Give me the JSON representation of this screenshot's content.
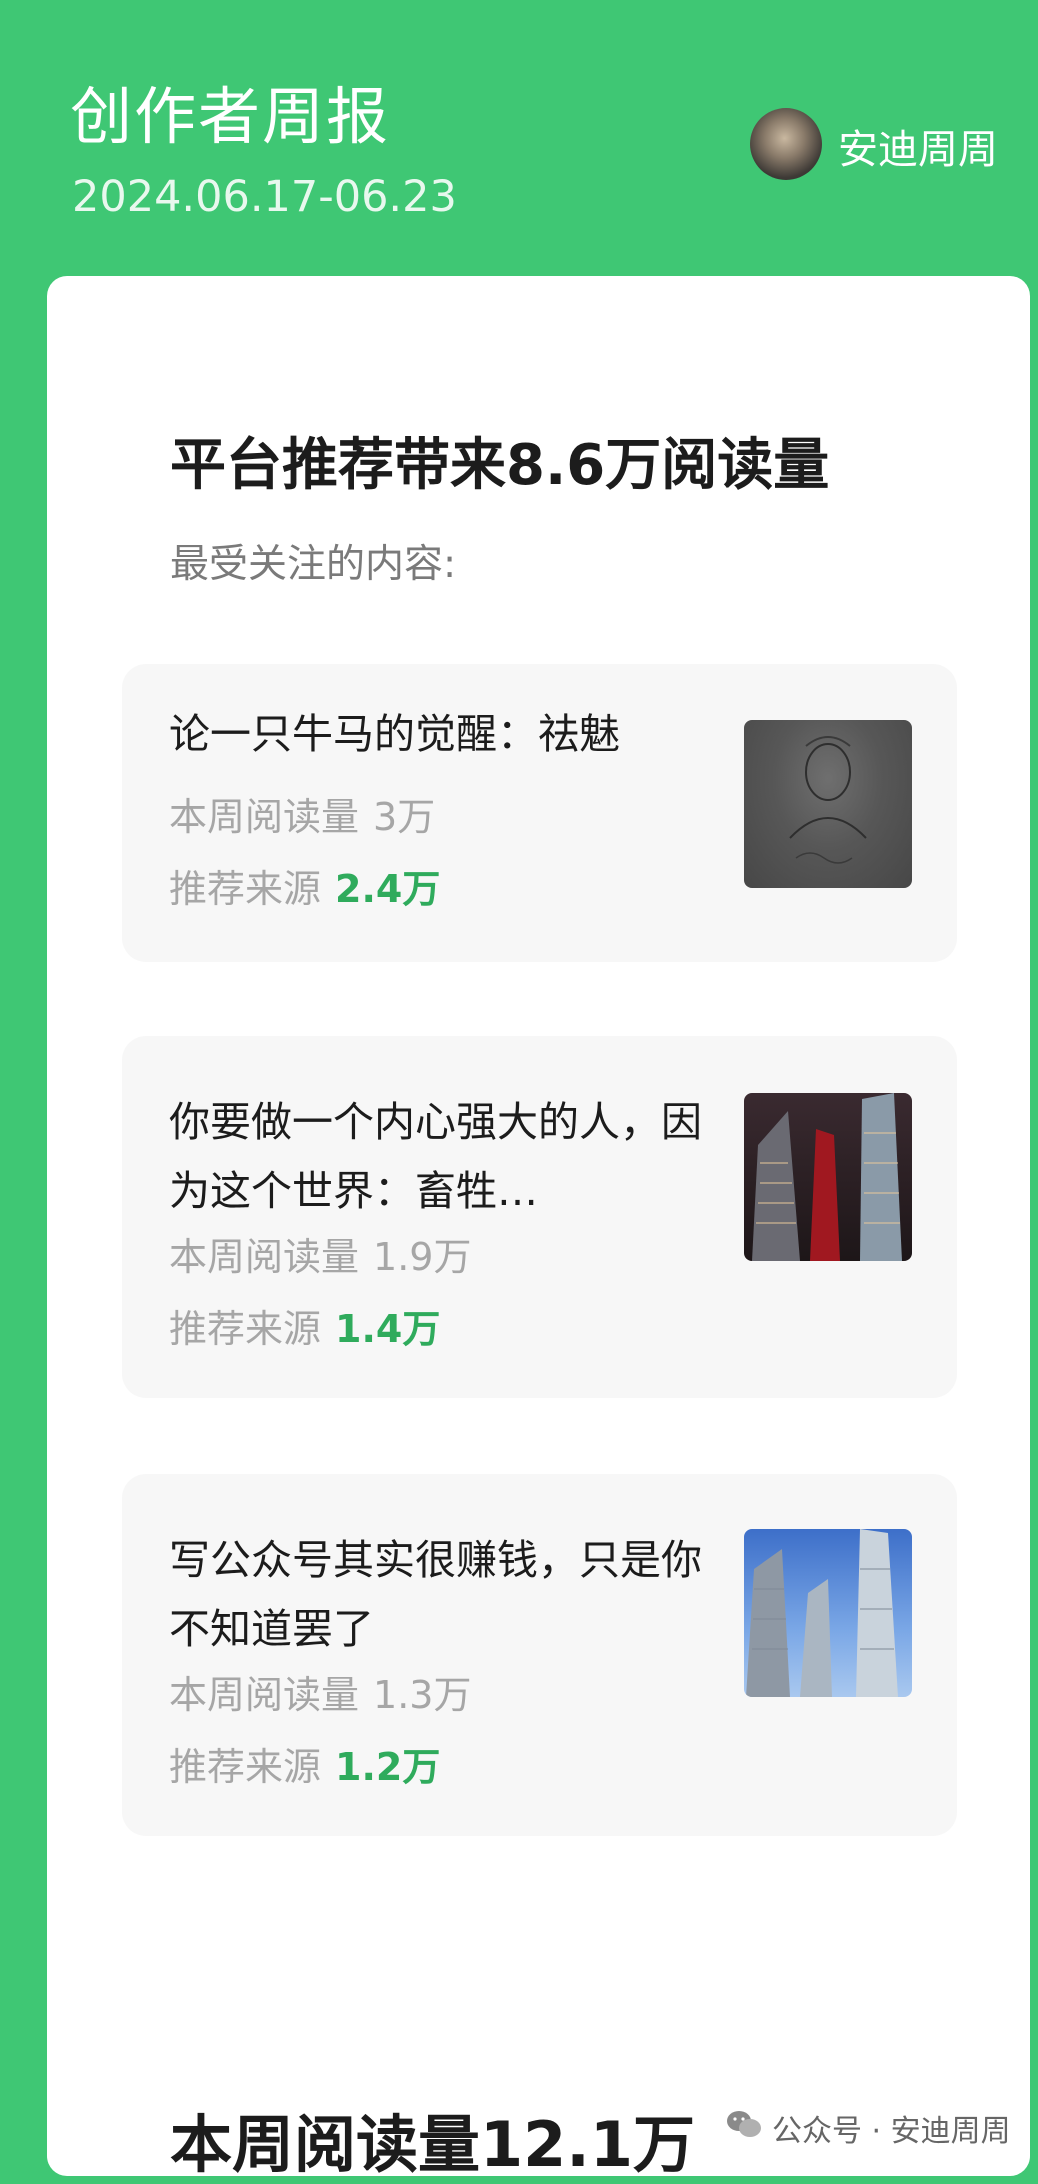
{
  "header": {
    "title": "创作者周报",
    "date_range": "2024.06.17-06.23",
    "user_name": "安迪周周"
  },
  "section": {
    "title": "平台推荐带来8.6万阅读量",
    "subtitle": "最受关注的内容:"
  },
  "labels": {
    "weekly_reads": "本周阅读量",
    "recommend_source": "推荐来源"
  },
  "articles": [
    {
      "title": "论一只牛马的觉醒：祛魅",
      "weekly_reads": "3万",
      "recommend": "2.4万",
      "thumb_desc": "dark-engraved-portrait"
    },
    {
      "title": "你要做一个内心强大的人，因为这个世界：畜牲…",
      "weekly_reads": "1.9万",
      "recommend": "1.4万",
      "thumb_desc": "night-skyscrapers"
    },
    {
      "title": "写公众号其实很赚钱，只是你不知道罢了",
      "weekly_reads": "1.3万",
      "recommend": "1.2万",
      "thumb_desc": "day-skyscrapers"
    }
  ],
  "next_section": {
    "title": "本周阅读量12.1万"
  },
  "watermark": {
    "text": "公众号 · 安迪周周",
    "icon": "wechat-icon"
  },
  "colors": {
    "brand_green": "#3fc774",
    "accent_green": "#2fab5c"
  }
}
